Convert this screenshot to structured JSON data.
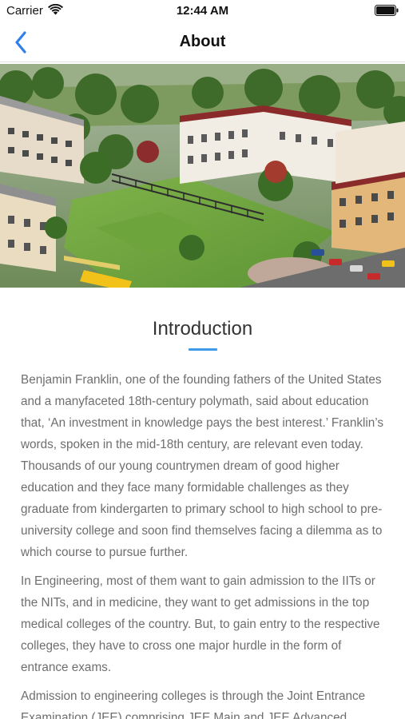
{
  "status_bar": {
    "carrier": "Carrier",
    "time": "12:44 AM",
    "wifi_icon": "wifi-icon",
    "battery_icon": "battery-icon"
  },
  "nav": {
    "title": "About",
    "back_icon": "chevron-left-icon",
    "accent_color": "#2f80ed"
  },
  "hero": {
    "image": "campus-aerial-illustration"
  },
  "intro": {
    "heading": "Introduction",
    "underline_color": "#3d9be9",
    "paragraphs": [
      "Benjamin Franklin, one of the founding fathers of the United States and a manyfaceted 18th-century polymath, said about education that, ‘An investment in knowledge pays the best interest.’ Franklin’s words, spoken in the mid-18th century, are relevant even today. Thousands of our young countrymen dream of good higher education and they face many formidable challenges as they graduate from kindergarten to primary school to high school to pre-university college and soon find themselves facing a dilemma as to which course to pursue further.",
      "In Engineering, most of them want to gain admission to the IITs or the NITs, and in medicine, they want to get admissions in the top medical colleges of the country. But, to gain entry to the respective colleges, they have to cross one major hurdle in the form of entrance exams.",
      "Admission to engineering colleges is through the Joint Entrance Examination (JEE) comprising JEE Main and JEE Advanced."
    ]
  }
}
